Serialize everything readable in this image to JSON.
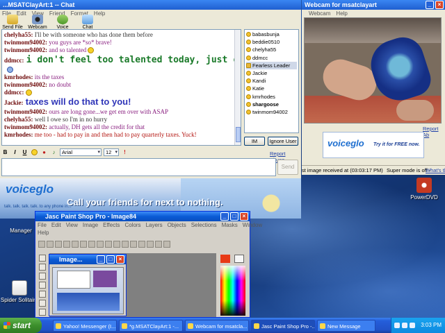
{
  "chat": {
    "title": "...MSATClayArt:1 -- Chat",
    "menu": [
      "File",
      "Edit",
      "View",
      "Friend",
      "Format",
      "Help"
    ],
    "toolbar": [
      "Send File",
      "Webcam",
      "Voice",
      "Chat"
    ],
    "messages": [
      {
        "nick": "chelyha55:",
        "text": "I'll be with someone who has done them before",
        "style": "t-dark"
      },
      {
        "nick": "twinmom94002:",
        "text": "you guys are *so* brave!",
        "style": "t-purple"
      },
      {
        "nick": "twinmom94002:",
        "text": "and so talented",
        "style": "t-purple",
        "emote": true
      },
      {
        "nick": "ddmcc:",
        "text": "i don't feel too talented today, just crazed!",
        "style": "t-green",
        "big": true
      },
      {
        "nick": "",
        "text": "",
        "style": "t-dark",
        "emote": true
      },
      {
        "nick": "kmrhodes:",
        "text": "its the taxes",
        "style": "t-purple"
      },
      {
        "nick": "twinmom94002:",
        "text": "no doubt",
        "style": "t-purple"
      },
      {
        "nick": "ddmcc:",
        "text": "",
        "style": "t-dark",
        "emote": true
      },
      {
        "nick": "Jackie:",
        "text": "taxes will do that to you!",
        "style": "t-blue",
        "big": true
      },
      {
        "nick": "twinmom94002:",
        "text": "ours are long gone...we get em over with ASAP",
        "style": "t-purple"
      },
      {
        "nick": "chelyha55:",
        "text": "well I owe so I'm in no hurry",
        "style": "t-dark"
      },
      {
        "nick": "twinmom94002:",
        "text": "actually, DH gets all the credit for that",
        "style": "t-purple"
      },
      {
        "nick": "kmrhodes:",
        "text": "me too - had to pay in and then had to pay quarterly taxes. Yuck!",
        "style": "t-red"
      }
    ],
    "users": [
      "babasbunja",
      "beddie0510",
      "chelyha55",
      "ddmcc",
      "Fearless Leader",
      "Jackie",
      "Kandi",
      "Katie",
      "kmrhodes",
      "shargoose",
      "twinmom94002"
    ],
    "selected_user": "Fearless Leader",
    "bold_user": "shargoose",
    "im_label": "IM",
    "ignore_label": "Ignore User",
    "report_abuse": "Report Abuse",
    "format": {
      "bold": "B",
      "italic": "I",
      "underline": "U",
      "font": "Arial",
      "size": "12"
    },
    "send_label": "Send",
    "input_value": ""
  },
  "ad": {
    "logo": "voiceglo",
    "tagline": "talk. talk. talk. talk. to any phone in...",
    "headline": "Call your friends for next to nothing."
  },
  "webcam": {
    "title": "Webcam for msatclayart",
    "menu": [
      "Webcam",
      "Help"
    ],
    "report_abuse": "Report Ab",
    "ad_logo": "voiceglo",
    "ad_cta": "Try it for FREE now.",
    "status_left": "st image received at (03:03:17 PM)",
    "status_mid": "Super mode is off -",
    "status_link": "What's th"
  },
  "desktop": {
    "icons": [
      {
        "label": "PowerDVD",
        "color": "#c43a22"
      },
      {
        "label": "Manager",
        "color": "#6c8ec8"
      },
      {
        "label": "Spider Solitaire",
        "color": "#d63a2b"
      }
    ]
  },
  "psp": {
    "title": "Jasc Paint Shop Pro - Image84",
    "menu": [
      "File",
      "Edit",
      "View",
      "Image",
      "Effects",
      "Colors",
      "Layers",
      "Objects",
      "Selections",
      "Masks",
      "Window"
    ],
    "menu2": [
      "Help"
    ],
    "child_title": "Image..."
  },
  "taskbar": {
    "start": "start",
    "tasks": [
      {
        "label": "Yahoo! Messenger (I...",
        "active": false
      },
      {
        "label": "*g.MSATClayArt:1 -...",
        "active": false
      },
      {
        "label": "Webcam for msatcla...",
        "active": false
      },
      {
        "label": "Jasc Paint Shop Pro -...",
        "active": true
      },
      {
        "label": "New Message",
        "active": false
      }
    ],
    "clock": "3:03 PM"
  }
}
